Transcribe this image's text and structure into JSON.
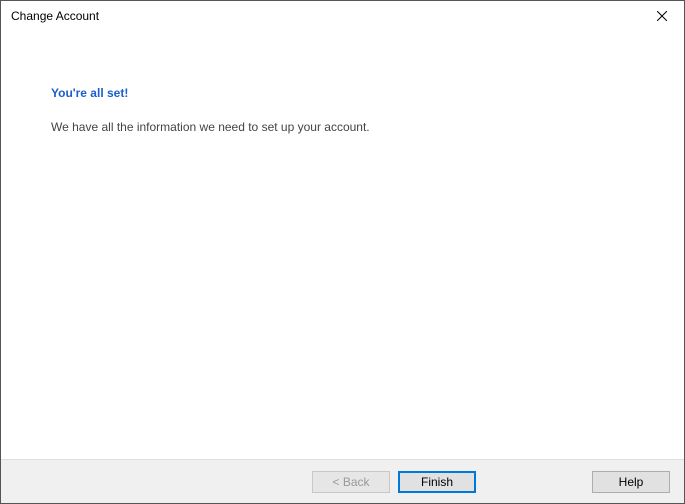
{
  "titlebar": {
    "title": "Change Account"
  },
  "content": {
    "heading": "You're all set!",
    "description": "We have all the information we need to set up your account."
  },
  "footer": {
    "back_label": "< Back",
    "finish_label": "Finish",
    "help_label": "Help"
  }
}
